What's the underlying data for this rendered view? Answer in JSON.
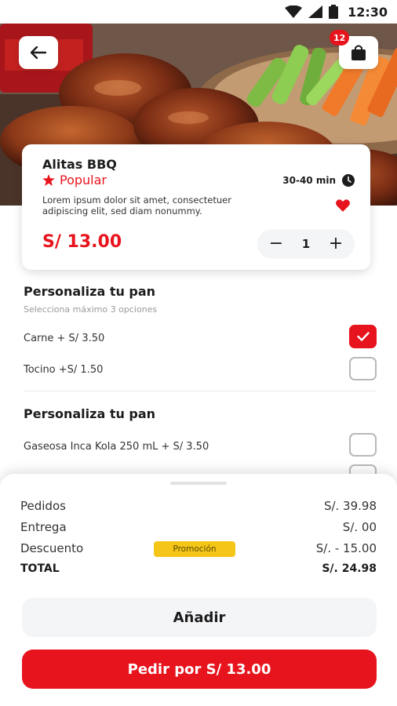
{
  "status_bar": {
    "time": "12:30"
  },
  "header": {
    "cart_count": "12"
  },
  "product": {
    "name": "Alitas BBQ",
    "tag": "Popular",
    "time": "30-40 min",
    "description": "Lorem ipsum dolor sit amet, consectetuer adipiscing elit, sed diam nonummy.",
    "price": "S/ 13.00",
    "quantity": "1",
    "favorite": true
  },
  "sections": [
    {
      "title": "Personaliza tu pan",
      "subtitle": "Selecciona máximo 3 opciones",
      "options": [
        {
          "label": "Carne + S/ 3.50",
          "checked": true
        },
        {
          "label": "Tocino +S/ 1.50",
          "checked": false
        }
      ]
    },
    {
      "title": "Personaliza tu pan",
      "options": [
        {
          "label": "Gaseosa Inca Kola 250 mL + S/ 3.50",
          "checked": false
        }
      ]
    }
  ],
  "summary": {
    "orders_label": "Pedidos",
    "orders_value": "S/. 39.98",
    "delivery_label": "Entrega",
    "delivery_value": "S/. 00",
    "discount_label": "Descuento",
    "discount_value": "S/. - 15.00",
    "promo_badge": "Promoción",
    "total_label": "TOTAL",
    "total_value": "S/. 24.98"
  },
  "actions": {
    "add_label": "Añadir",
    "order_label": "Pedir por S/ 13.00"
  },
  "colors": {
    "accent": "#e8141d",
    "promo": "#f5c518",
    "button_bg": "#f4f5f7"
  }
}
